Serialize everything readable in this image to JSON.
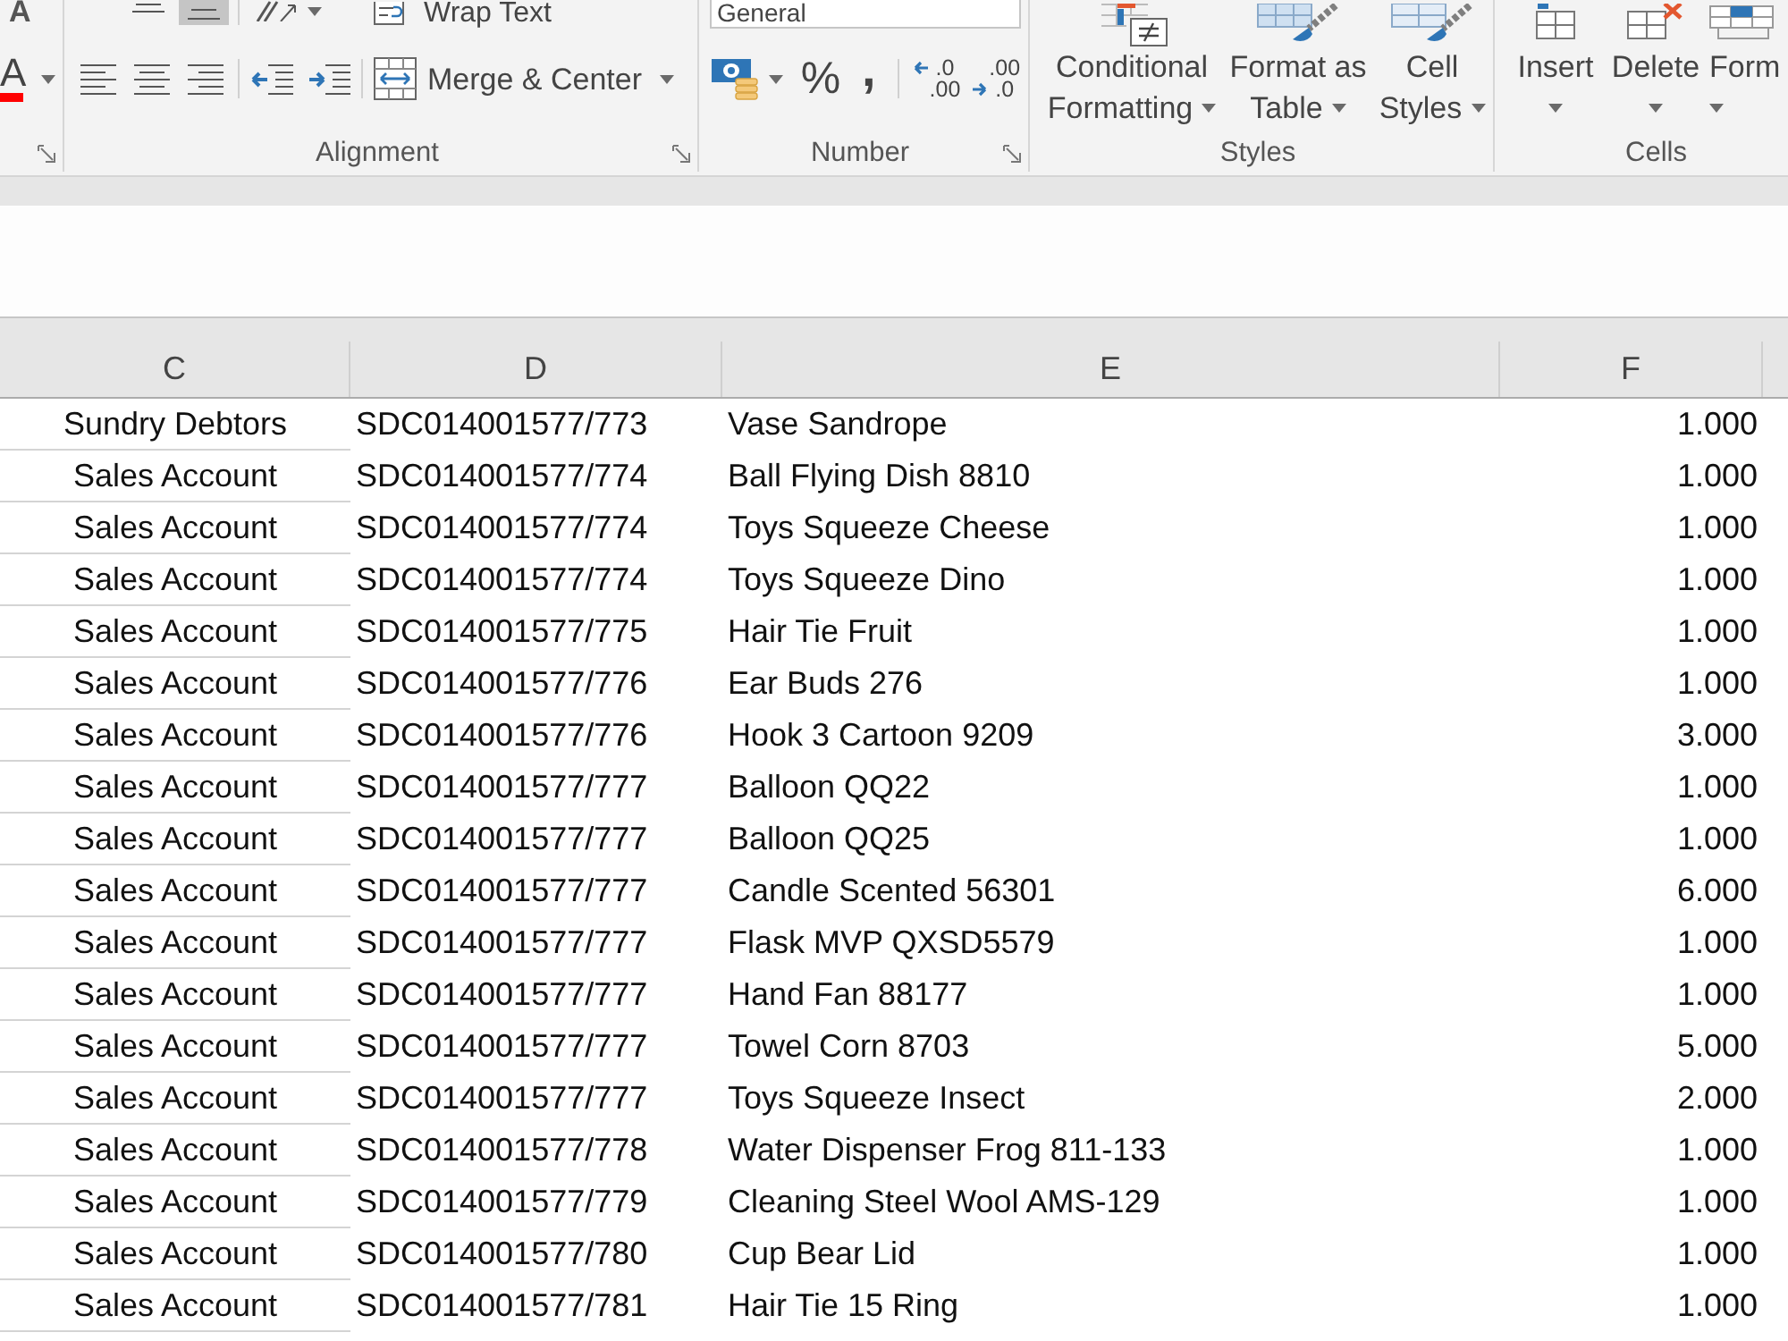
{
  "ribbon": {
    "font": {
      "size_glyph": "A",
      "color_glyph": "A"
    },
    "alignment": {
      "label": "Alignment",
      "vertical": [
        {
          "kind": "middle",
          "selected": false
        },
        {
          "kind": "bottom",
          "selected": true
        }
      ],
      "wrap_text": "Wrap Text",
      "horizontal": [
        {
          "kind": "left",
          "selected": false
        },
        {
          "kind": "center",
          "selected": false
        },
        {
          "kind": "right",
          "selected": false
        }
      ],
      "merge": "Merge & Center"
    },
    "number": {
      "label": "Number",
      "format": "General",
      "percent": "%",
      "comma": ",",
      "increase_decimal": [
        ".0",
        ".00"
      ],
      "decrease_decimal": [
        ".00",
        ".0"
      ]
    },
    "styles": {
      "label": "Styles",
      "buttons": [
        {
          "kind": "conditional",
          "lines": [
            "Conditional",
            "Formatting"
          ]
        },
        {
          "kind": "table",
          "lines": [
            "Format as",
            "Table"
          ]
        },
        {
          "kind": "cell",
          "lines": [
            "Cell",
            "Styles"
          ]
        }
      ]
    },
    "cells": {
      "label": "Cells",
      "buttons": [
        {
          "kind": "insert",
          "label": "Insert"
        },
        {
          "kind": "delete",
          "label": "Delete"
        },
        {
          "kind": "format",
          "label": "Form"
        }
      ]
    }
  },
  "sheet": {
    "columns": [
      "C",
      "D",
      "E",
      "F"
    ],
    "rows": [
      [
        "Sundry Debtors",
        "SDC014001577/773",
        "Vase Sandrope",
        "1.000"
      ],
      [
        "Sales Account",
        "SDC014001577/774",
        "Ball Flying Dish 8810",
        "1.000"
      ],
      [
        "Sales Account",
        "SDC014001577/774",
        "Toys Squeeze Cheese",
        "1.000"
      ],
      [
        "Sales Account",
        "SDC014001577/774",
        "Toys Squeeze Dino",
        "1.000"
      ],
      [
        "Sales Account",
        "SDC014001577/775",
        "Hair Tie Fruit",
        "1.000"
      ],
      [
        "Sales Account",
        "SDC014001577/776",
        "Ear Buds 276",
        "1.000"
      ],
      [
        "Sales Account",
        "SDC014001577/776",
        "Hook 3 Cartoon 9209",
        "3.000"
      ],
      [
        "Sales Account",
        "SDC014001577/777",
        "Balloon QQ22",
        "1.000"
      ],
      [
        "Sales Account",
        "SDC014001577/777",
        "Balloon QQ25",
        "1.000"
      ],
      [
        "Sales Account",
        "SDC014001577/777",
        "Candle Scented 56301",
        "6.000"
      ],
      [
        "Sales Account",
        "SDC014001577/777",
        "Flask MVP QXSD5579",
        "1.000"
      ],
      [
        "Sales Account",
        "SDC014001577/777",
        "Hand Fan 88177",
        "1.000"
      ],
      [
        "Sales Account",
        "SDC014001577/777",
        "Towel Corn 8703",
        "5.000"
      ],
      [
        "Sales Account",
        "SDC014001577/777",
        "Toys Squeeze Insect",
        "2.000"
      ],
      [
        "Sales Account",
        "SDC014001577/778",
        "Water Dispenser Frog 811-133",
        "1.000"
      ],
      [
        "Sales Account",
        "SDC014001577/779",
        "Cleaning Steel Wool AMS-129",
        "1.000"
      ],
      [
        "Sales Account",
        "SDC014001577/780",
        "Cup Bear Lid",
        "1.000"
      ],
      [
        "Sales Account",
        "SDC014001577/781",
        "Hair Tie 15 Ring",
        "1.000"
      ]
    ]
  }
}
